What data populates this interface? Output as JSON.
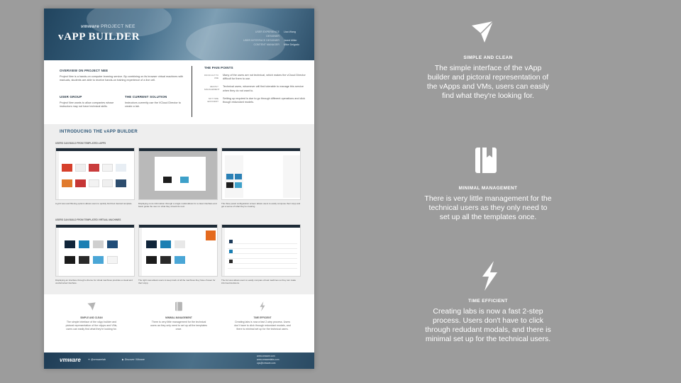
{
  "poster": {
    "brand": "vmware",
    "brand_suffix": "PROJECT NEE",
    "title": "vAPP BUILDER",
    "credits": [
      {
        "k": "USER EXPERIENCE DESIGNER",
        "v": "Lisa Wang"
      },
      {
        "k": "USER INTERFACE DESIGNER",
        "v": "Jared Miller"
      },
      {
        "k": "CONTENT MANAGER",
        "v": "Mike Delgado"
      }
    ],
    "overview": {
      "heading": "OVERVIEW ON PROJECT NEE",
      "text": "Project Nee is a hands-on computer learning service. By combining on its browser virtual machines with manuals, students are able to receive hands-on training experience of a live cell."
    },
    "user_group": {
      "heading": "USER GROUP",
      "text": "Project Nee wants to allow companies whose instructors may not have technical skills."
    },
    "current_solution": {
      "heading": "THE CURRENT SOLUTION",
      "text": "Instructors currently use the VCloud Director to create a lab."
    },
    "pain_points": {
      "heading": "THE PAIN POINTS",
      "items": [
        {
          "k": "DIFFICULT TO USE",
          "v": "Many of the users are not technical, which makes the vCloud Director difficult for them to use."
        },
        {
          "k": "HEAVILY MANAGEMENT",
          "v": "Technical users, whomever will find tolerable to manage this service when they do not want to."
        },
        {
          "k": "NOT TIME EFFICIENT",
          "v": "Setting up required is due to go through different operations and click though redundant models."
        }
      ]
    },
    "introducing": "INTRODUCING THE vAPP BUILDER",
    "row1_label": "USERS CAN BUILD FROM TEMPLATED vAPPS",
    "row2_label": "USERS CAN BUILD FROM TEMPLATED VIRTUAL MACHINES",
    "captions": [
      "A grid view and filtering options allows users to quickly find their desired template.",
      "Displaying more information through a single modal allows for a clean interface and basic guide the user on what they should do next.",
      "The three panel configuration screen allows users to easily compose their vApp and get a sense of what they're creating.",
      "Displaying an interface through a theme for virtual machines provides a visual and unobstructed interface.",
      "The right view allows users to keep track of all the machines they have chosen for their vApp.",
      "The list view allows users to easily compare virtual machines so they can make informed decisions."
    ],
    "features": [
      {
        "heading": "SIMPLE AND CLEAN",
        "text": "The simple interface of the vApp builder and pictoral representation of the vApps and VMs, users can easily find what they're looking for."
      },
      {
        "heading": "MINIMAL MANAGEMENT",
        "text": "There is very little management for the technical users as they only need to set up all the templates once."
      },
      {
        "heading": "TIME EFFICIENT",
        "text": "Creating labs is now a fast 2-step process. Users don't have to click through redundant modals, and there is minimal set up for the technical users."
      }
    ],
    "footer": {
      "logo": "vmware",
      "twitter": "@vmwarelab",
      "youtube": "Discover VMware",
      "contacts": [
        "www.vmware.com",
        "www.vmwarelabs.com",
        "ops@vmware.com"
      ]
    }
  },
  "right_panel": [
    {
      "icon": "paper-plane-icon",
      "heading": "SIMPLE AND CLEAN",
      "text": "The simple interface of the vApp builder and pictoral representation of the vApps and VMs, users can easily find what they're looking for."
    },
    {
      "icon": "book-icon",
      "heading": "MINIMAL MANAGEMENT",
      "text": "There is very little management for the technical users as they only need to set up all the templates once."
    },
    {
      "icon": "lightning-icon",
      "heading": "TIME EFFICIENT",
      "text": "Creating labs is now a fast 2-step process. Users don't have to click through redudant modals, and there is minimal set up for the technical users."
    }
  ],
  "colors": {
    "background": "#9c9c9c",
    "accent": "#2b5576",
    "header": "#3d6886"
  }
}
